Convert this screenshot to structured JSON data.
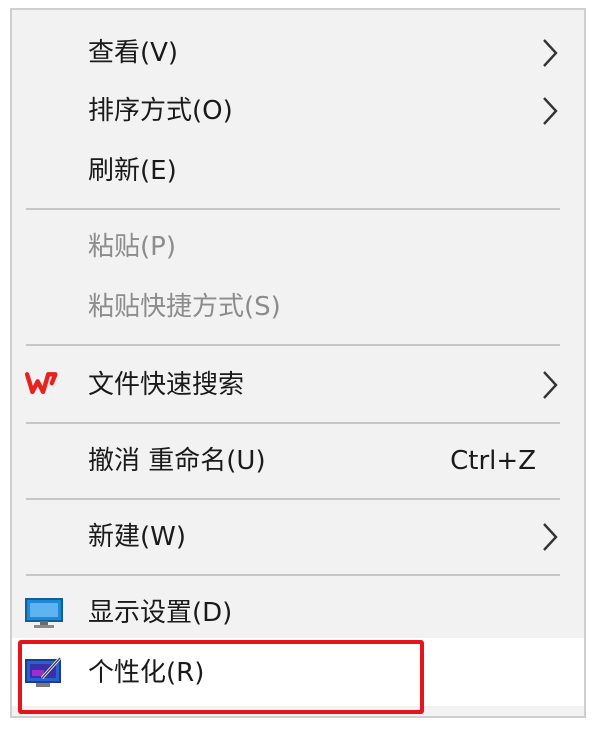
{
  "menu": {
    "items": [
      {
        "id": "view",
        "label": "查看(V)",
        "submenu": true,
        "disabled": false
      },
      {
        "id": "sort",
        "label": "排序方式(O)",
        "submenu": true,
        "disabled": false
      },
      {
        "id": "refresh",
        "label": "刷新(E)",
        "submenu": false,
        "disabled": false
      },
      {
        "id": "paste",
        "label": "粘贴(P)",
        "submenu": false,
        "disabled": true
      },
      {
        "id": "paste-shortcut",
        "label": "粘贴快捷方式(S)",
        "submenu": false,
        "disabled": true
      },
      {
        "id": "wps-search",
        "label": "文件快速搜索",
        "submenu": true,
        "disabled": false,
        "icon": "wps-logo-icon"
      },
      {
        "id": "undo-rename",
        "label": "撤消 重命名(U)",
        "shortcut": "Ctrl+Z",
        "submenu": false,
        "disabled": false
      },
      {
        "id": "new",
        "label": "新建(W)",
        "submenu": true,
        "disabled": false
      },
      {
        "id": "display-settings",
        "label": "显示设置(D)",
        "submenu": false,
        "disabled": false,
        "icon": "monitor-icon"
      },
      {
        "id": "personalize",
        "label": "个性化(R)",
        "submenu": false,
        "disabled": false,
        "icon": "personalize-icon",
        "highlighted": true
      }
    ]
  },
  "colors": {
    "menu_bg": "#f2f2f2",
    "highlight_border": "#e8141b",
    "disabled_text": "#8c8c8c",
    "wps_red": "#e8231f"
  }
}
